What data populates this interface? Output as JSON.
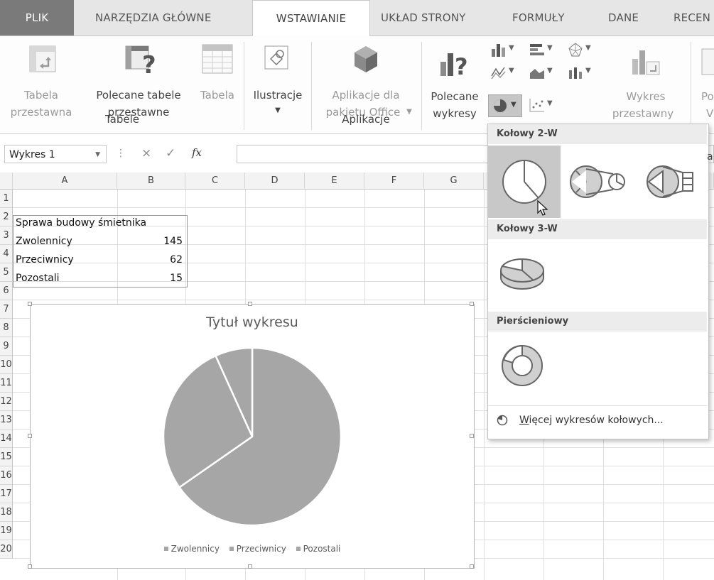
{
  "tabs": [
    {
      "label": "PLIK"
    },
    {
      "label": "NARZĘDZIA GŁÓWNE"
    },
    {
      "label": "WSTAWIANIE"
    },
    {
      "label": "UKŁAD STRONY"
    },
    {
      "label": "FORMUŁY"
    },
    {
      "label": "DANE"
    },
    {
      "label": "RECEN"
    }
  ],
  "ribbon": {
    "pivot": {
      "line1": "Tabela",
      "line2": "przestawna"
    },
    "recommended_pivot": {
      "line1": "Polecane tabele",
      "line2": "przestawne"
    },
    "table": {
      "label": "Tabela"
    },
    "group_tables": "Tabele",
    "illustrations": {
      "label": "Ilustracje"
    },
    "apps": {
      "line1": "Aplikacje dla",
      "line2": "pakietu Office"
    },
    "group_apps": "Aplikacje",
    "recommended_charts": {
      "line1": "Polecane",
      "line2": "wykresy"
    },
    "pivot_chart": {
      "line1": "Wykres",
      "line2": "przestawny"
    },
    "edge_fragment_1": "Po",
    "edge_fragment_2": "V",
    "edge_fragment_3": "a"
  },
  "formula_bar": {
    "name_box": "Wykres 1",
    "cancel": "×",
    "enter": "✓",
    "fx": "fx"
  },
  "sheet": {
    "columns": [
      "A",
      "B",
      "C",
      "D",
      "E",
      "F",
      "G"
    ],
    "rows": [
      "1",
      "2",
      "3",
      "4",
      "5",
      "6",
      "7",
      "8",
      "9",
      "10",
      "11",
      "12",
      "13",
      "14",
      "15",
      "16",
      "17",
      "18",
      "19",
      "20"
    ],
    "cells": {
      "a1": "Sprawa budowy śmietnika",
      "a2": "Zwolennicy",
      "b2": "145",
      "a3": "Przeciwnicy",
      "b3": "62",
      "a4": "Pozostali",
      "b4": "15"
    }
  },
  "chart_data": {
    "type": "pie",
    "title": "Tytuł wykresu",
    "categories": [
      "Zwolennicy",
      "Przeciwnicy",
      "Pozostali"
    ],
    "values": [
      145,
      62,
      15
    ],
    "legend_position": "bottom",
    "colors": [
      "#a6a6a6",
      "#a6a6a6",
      "#a6a6a6"
    ]
  },
  "gallery": {
    "section_2d": "Kołowy 2-W",
    "section_3d": "Kołowy 3-W",
    "section_donut": "Pierścieniowy",
    "more_prefix": "W",
    "more_rest": "ięcej wykresów kołowych..."
  }
}
